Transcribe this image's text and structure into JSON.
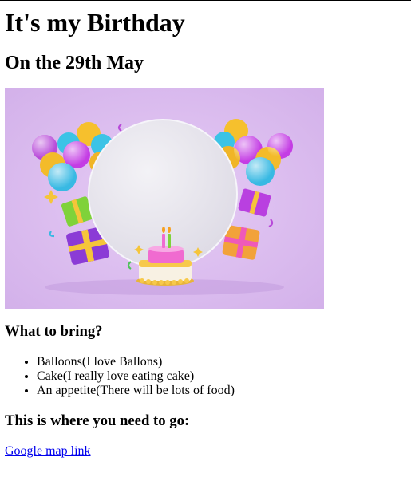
{
  "page": {
    "title": "It's my Birthday",
    "subtitle": "On the 29th May"
  },
  "image": {
    "colors": {
      "background": "#d9b9ee",
      "plate": "#ecebf0",
      "cake_pink": "#f06bd0",
      "cake_yellow": "#f7c94a"
    }
  },
  "bring": {
    "heading": "What to bring?",
    "items": [
      "Balloons(I love Ballons)",
      "Cake(I really love eating cake)",
      "An appetite(There will be lots of food)"
    ]
  },
  "directions": {
    "heading": "This is where you need to go:",
    "link_label": "Google map link"
  },
  "colors": {
    "link": "#0000ee",
    "text": "#000000"
  }
}
